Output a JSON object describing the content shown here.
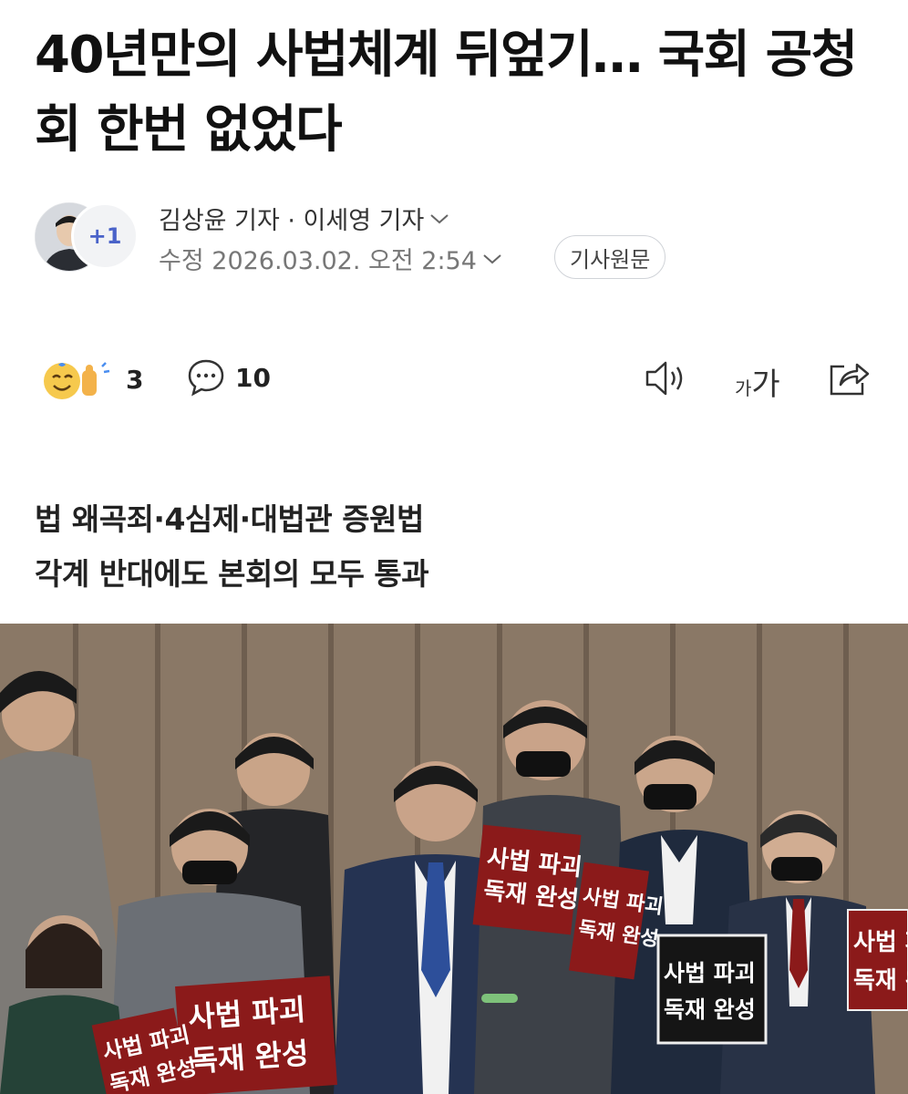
{
  "article": {
    "headline": "40년만의 사법체계 뒤엎기… 국회 공청회 한번 없었다",
    "reporters": "김상윤 기자 · 이세영 기자",
    "extra_reporters_badge": "+1",
    "modified": "수정 2026.03.02. 오전 2:54",
    "original_button": "기사원문",
    "subhead_lines": [
      "법 왜곡죄·4심제·대법관 증원법",
      "각계 반대에도 본회의 모두 통과"
    ]
  },
  "actions": {
    "reaction_count": "3",
    "comment_count": "10",
    "font_size_small": "가",
    "font_size_large": "가"
  },
  "photo": {
    "signs": [
      "사법 파괴",
      "독재 완성"
    ]
  },
  "icons": [
    "chevron-down-icon",
    "reaction-emoji-icon",
    "comment-icon",
    "speaker-icon",
    "share-icon"
  ],
  "colors": {
    "badge_text": "#4a63c9",
    "reaction_yellow": "#f6c94d",
    "sign_red": "#8b1a1a"
  }
}
